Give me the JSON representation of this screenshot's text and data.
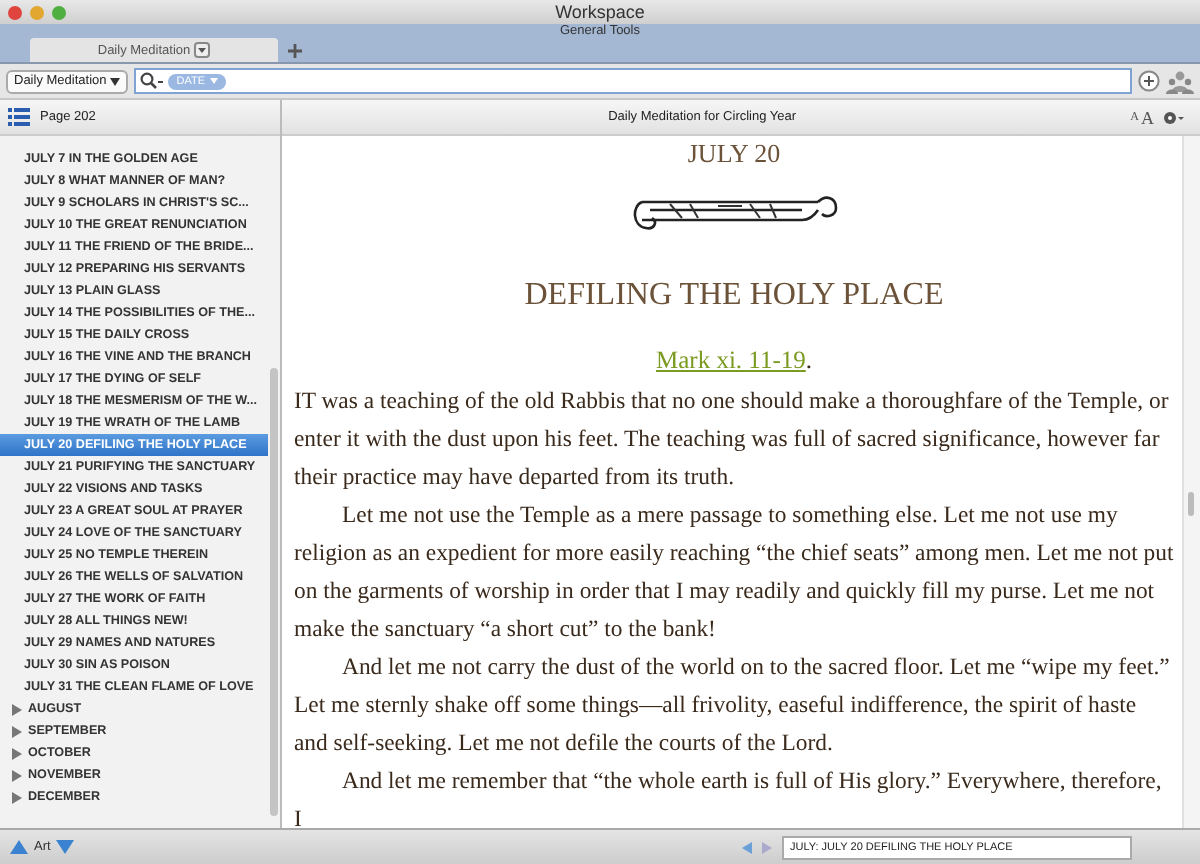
{
  "window": {
    "title": "Workspace",
    "subtitle": "General Tools"
  },
  "tabs": [
    {
      "label": "Daily Meditation",
      "selected": true
    }
  ],
  "toolbar": {
    "book": "Daily Meditation",
    "search_tag": "DATE"
  },
  "sidebar": {
    "page": "Page 202",
    "items": [
      {
        "label": "JULY 7 IN THE GOLDEN AGE",
        "selected": false
      },
      {
        "label": "JULY 8 WHAT MANNER OF MAN?",
        "selected": false
      },
      {
        "label": "JULY 9 SCHOLARS IN CHRIST'S SC...",
        "selected": false
      },
      {
        "label": "JULY 10 THE GREAT RENUNCIATION",
        "selected": false
      },
      {
        "label": "JULY 11 THE FRIEND OF THE BRIDE...",
        "selected": false
      },
      {
        "label": "JULY 12 PREPARING HIS SERVANTS",
        "selected": false
      },
      {
        "label": "JULY 13 PLAIN GLASS",
        "selected": false
      },
      {
        "label": "JULY 14 THE POSSIBILITIES OF THE...",
        "selected": false
      },
      {
        "label": "JULY 15 THE DAILY CROSS",
        "selected": false
      },
      {
        "label": "JULY 16 THE VINE AND THE BRANCH",
        "selected": false
      },
      {
        "label": "JULY 17 THE DYING OF SELF",
        "selected": false
      },
      {
        "label": "JULY 18 THE MESMERISM OF THE W...",
        "selected": false
      },
      {
        "label": "JULY 19 THE WRATH OF THE LAMB",
        "selected": false
      },
      {
        "label": "JULY 20 DEFILING THE HOLY PLACE",
        "selected": true
      },
      {
        "label": "JULY 21 PURIFYING THE SANCTUARY",
        "selected": false
      },
      {
        "label": "JULY 22 VISIONS AND TASKS",
        "selected": false
      },
      {
        "label": "JULY 23 A GREAT SOUL AT PRAYER",
        "selected": false
      },
      {
        "label": "JULY 24 LOVE OF THE SANCTUARY",
        "selected": false
      },
      {
        "label": "JULY 25 NO TEMPLE THEREIN",
        "selected": false
      },
      {
        "label": "JULY 26 THE WELLS OF SALVATION",
        "selected": false
      },
      {
        "label": "JULY 27 THE WORK OF FAITH",
        "selected": false
      },
      {
        "label": "JULY 28 ALL THINGS NEW!",
        "selected": false
      },
      {
        "label": "JULY 29 NAMES AND NATURES",
        "selected": false
      },
      {
        "label": "JULY 30 SIN AS POISON",
        "selected": false
      },
      {
        "label": "JULY 31 THE CLEAN FLAME OF LOVE",
        "selected": false
      }
    ],
    "months": [
      {
        "label": "AUGUST",
        "expanded": false
      },
      {
        "label": "SEPTEMBER",
        "expanded": false
      },
      {
        "label": "OCTOBER",
        "expanded": false
      },
      {
        "label": "NOVEMBER",
        "expanded": false
      },
      {
        "label": "DECEMBER",
        "expanded": false
      }
    ],
    "footer": "Art"
  },
  "reader": {
    "title": "Daily Meditation for Circling Year",
    "font_buttons": [
      "A",
      "A"
    ],
    "date": "JULY 20",
    "heading": "DEFILING THE HOLY PLACE",
    "reference": "Mark xi. 11-19",
    "reference_end": ".",
    "paragraphs": [
      "IT was a teaching of the old Rabbis that no one should make a thoroughfare of the Temple, or enter it with the dust upon his feet. The teaching was full of sacred significance, however far their practice may have departed from its truth.",
      "Let me not use the Temple as a mere passage to something else. Let me not use my religion as an expedient for more easily reaching “the chief seats” among men. Let me not put on the garments of worship in order that I may readily and quickly fill my purse. Let me not make the sanctuary “a short cut” to the bank!",
      "And let me not carry the dust of the world on to the sacred floor. Let me “wipe my feet.” Let me sternly shake off some things—all frivolity, easeful indifference, the spirit of haste and self-seeking. Let me not defile the courts of the Lord.",
      "And let me remember that “the whole earth is full of His glory.” Everywhere, therefore, I"
    ],
    "location": "JULY: JULY 20 DEFILING THE HOLY PLACE"
  }
}
